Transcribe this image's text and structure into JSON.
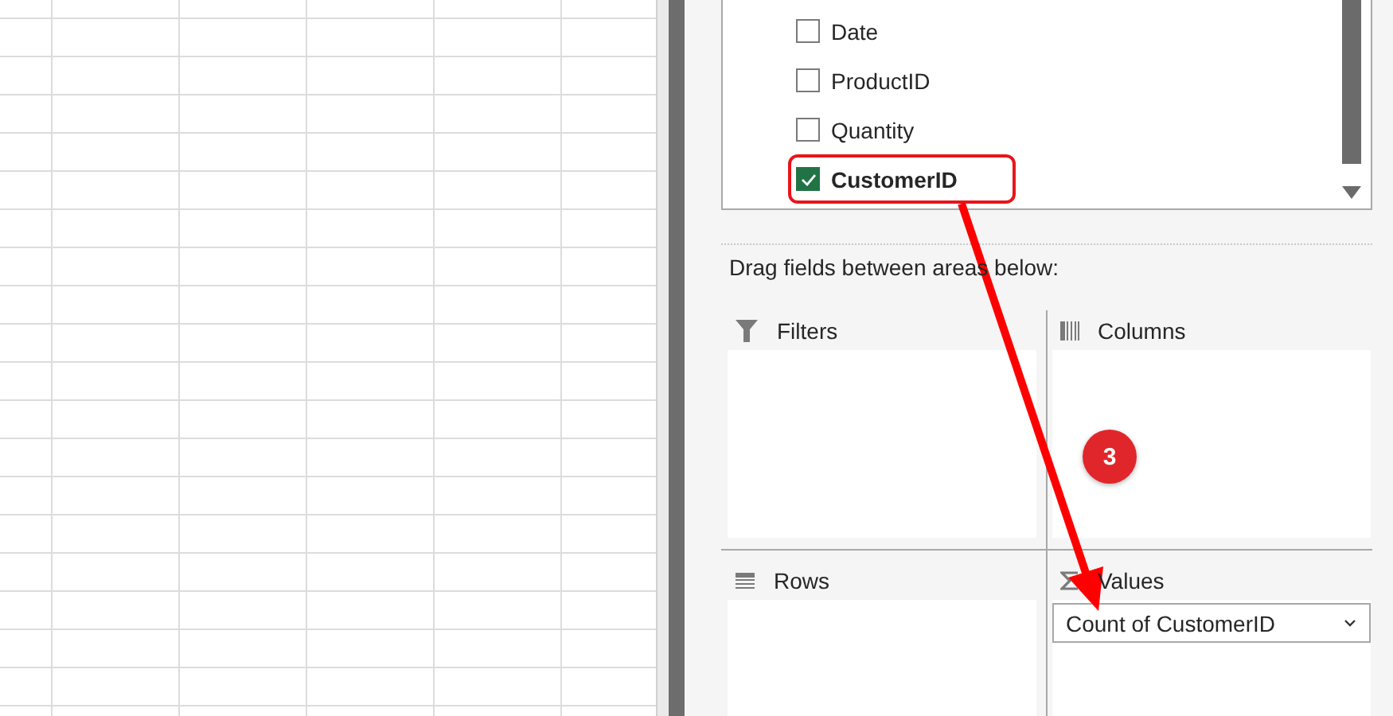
{
  "field_list": {
    "fields": [
      {
        "label": "Date",
        "checked": false
      },
      {
        "label": "ProductID",
        "checked": false
      },
      {
        "label": "Quantity",
        "checked": false
      },
      {
        "label": "CustomerID",
        "checked": true
      }
    ]
  },
  "areas_hint": "Drag fields between areas below:",
  "areas": [
    {
      "kind": "filters",
      "label": "Filters"
    },
    {
      "kind": "columns",
      "label": "Columns"
    },
    {
      "kind": "rows",
      "label": "Rows"
    },
    {
      "kind": "values",
      "label": "Values",
      "items": [
        "Count of CustomerID"
      ]
    }
  ],
  "annotation": {
    "step": "3"
  }
}
